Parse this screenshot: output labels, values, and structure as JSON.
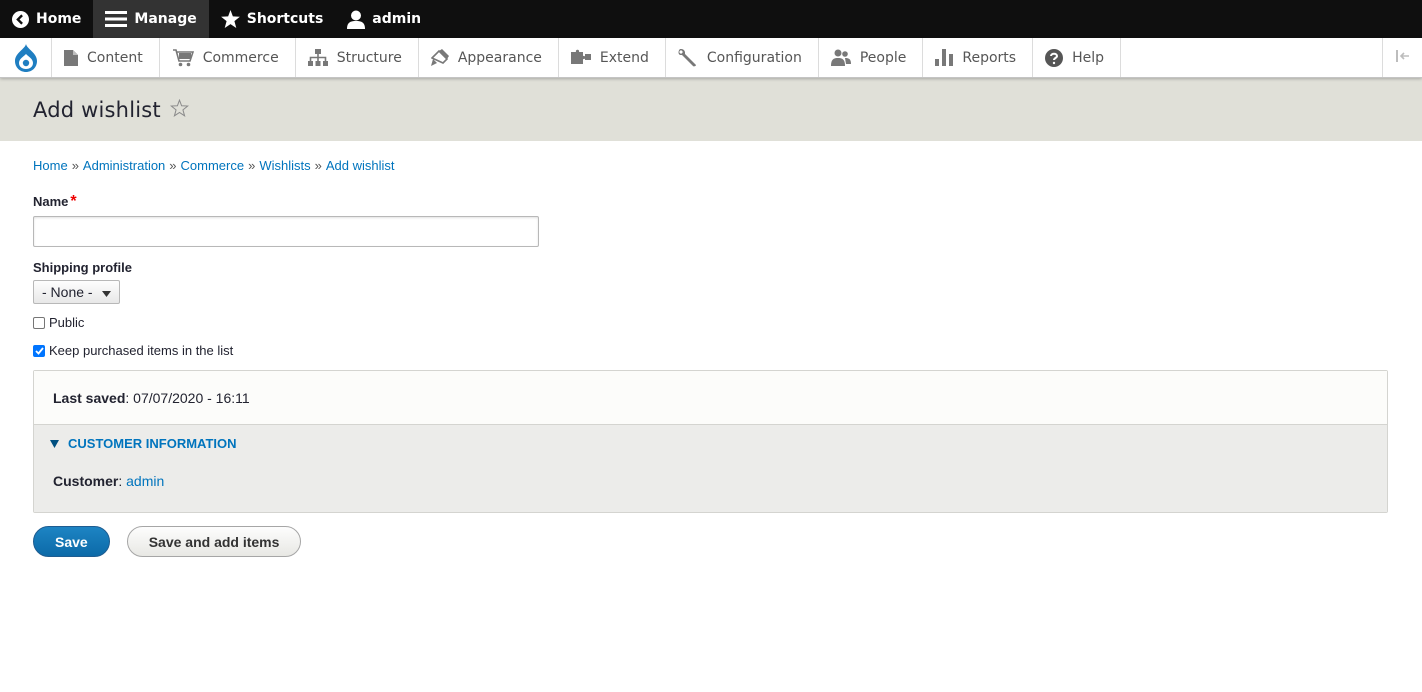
{
  "toolbar": {
    "home_label": "Home",
    "manage_label": "Manage",
    "shortcuts_label": "Shortcuts",
    "user_label": "admin"
  },
  "tray": {
    "items": [
      {
        "label": "Content",
        "icon": "file-icon"
      },
      {
        "label": "Commerce",
        "icon": "cart-icon"
      },
      {
        "label": "Structure",
        "icon": "sitemap-icon"
      },
      {
        "label": "Appearance",
        "icon": "brush-icon"
      },
      {
        "label": "Extend",
        "icon": "puzzle-icon"
      },
      {
        "label": "Configuration",
        "icon": "wrench-icon"
      },
      {
        "label": "People",
        "icon": "people-icon"
      },
      {
        "label": "Reports",
        "icon": "bar-chart-icon"
      },
      {
        "label": "Help",
        "icon": "help-icon"
      }
    ]
  },
  "page": {
    "title": "Add wishlist"
  },
  "breadcrumb": {
    "items": [
      "Home",
      "Administration",
      "Commerce",
      "Wishlists",
      "Add wishlist"
    ],
    "separator": "»"
  },
  "form": {
    "name_label": "Name",
    "required_mark": "*",
    "name_value": "",
    "shipping_label": "Shipping profile",
    "shipping_selected": "- None -",
    "public_label": "Public",
    "public_checked": false,
    "keep_label": "Keep purchased items in the list",
    "keep_checked": true
  },
  "meta": {
    "last_saved_label": "Last saved",
    "last_saved_value": "07/07/2020 - 16:11",
    "customer_section_title": "Customer information",
    "customer_label": "Customer",
    "customer_value": "admin"
  },
  "actions": {
    "save_label": "Save",
    "save_add_label": "Save and add items"
  },
  "colors": {
    "link": "#0074bd",
    "primary_button": "#0c6aa8",
    "header_bg": "#e0e0d8",
    "toolbar_bg": "#0f0f0f"
  }
}
